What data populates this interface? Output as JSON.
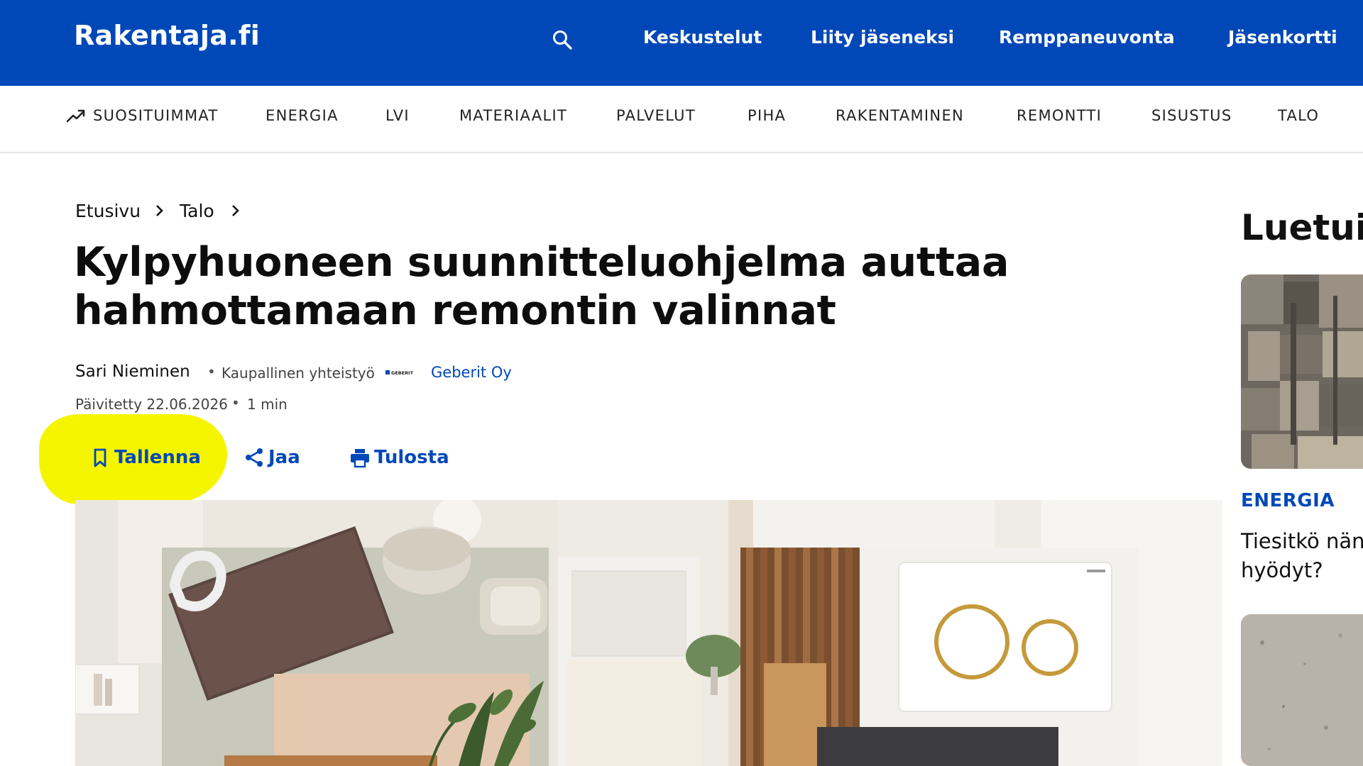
{
  "header": {
    "logo": "Rakentaja.fi",
    "search_icon": "search-icon",
    "nav": [
      "Keskustelut",
      "Liity jäseneksi",
      "Remppaneuvonta",
      "Jäsenkortti"
    ]
  },
  "categories": {
    "trend_icon": "trending-up-icon",
    "items": [
      "SUOSITUIMMAT",
      "ENERGIA",
      "LVI",
      "MATERIAALIT",
      "PALVELUT",
      "PIHA",
      "RAKENTAMINEN",
      "REMONTTI",
      "SISUSTUS",
      "TALO"
    ]
  },
  "breadcrumb": [
    "Etusivu",
    "Talo"
  ],
  "article": {
    "title": "Kylpyhuoneen suunnitteluohjelma auttaa hahmottamaan remontin valinnat",
    "author": "Sari Nieminen",
    "sponsor_label": "Kaupallinen yhteistyö",
    "partner_logo_text": "GEBERIT",
    "partner": "Geberit Oy",
    "updated": "Päivitetty 22.06.2026",
    "read_time": "1 min"
  },
  "actions": {
    "save": "Tallenna",
    "share": "Jaa",
    "print": "Tulosta"
  },
  "sidebar": {
    "heading": "Luetuin",
    "category": "ENERGIA",
    "article_title_line1": "Tiesitkö nän",
    "article_title_line2": "hyödyt?"
  },
  "colors": {
    "brand_blue": "#0048b8",
    "highlight": "#f5f500"
  }
}
